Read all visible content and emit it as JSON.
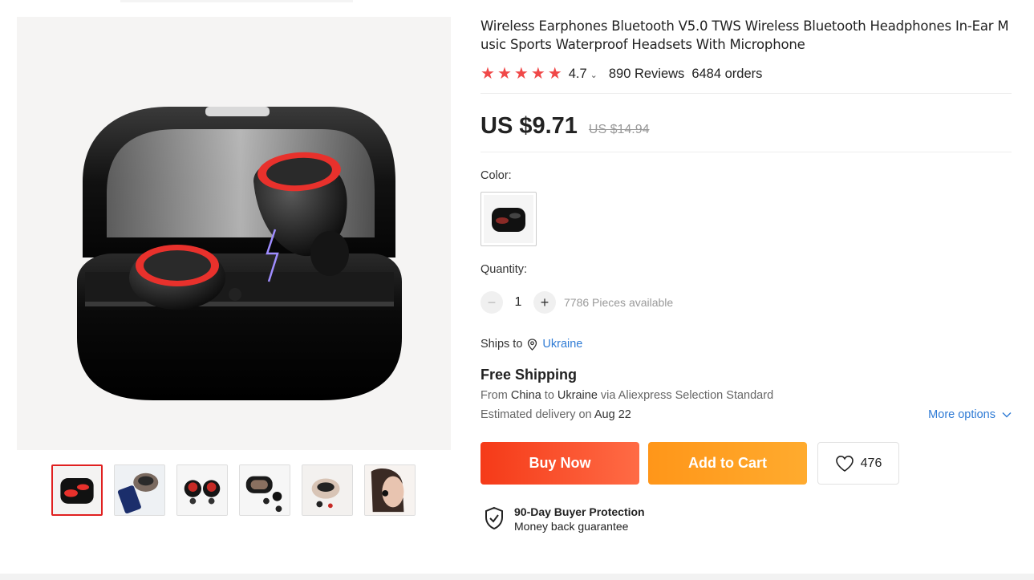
{
  "product": {
    "title": "Wireless Earphones Bluetooth V5.0 TWS Wireless Bluetooth Headphones In-Ear Music Sports Waterproof Headsets With Microphone",
    "rating": "4.7",
    "stars_filled": 5,
    "reviews": "890 Reviews",
    "orders": "6484 orders",
    "price": "US $9.71",
    "old_price": "US $14.94",
    "accent_color": "#f04848"
  },
  "gallery": {
    "main_image": "black-earbuds-charging-case-red-rings",
    "thumbnails": [
      "earbuds-case-open",
      "earbuds-with-phone",
      "two-earbuds",
      "case-and-buds",
      "case-closeup",
      "woman-wearing-earbud"
    ],
    "selected_index": 0
  },
  "color": {
    "label": "Color:",
    "selected": "black-earbuds-case"
  },
  "quantity": {
    "label": "Quantity:",
    "minus": "−",
    "value": "1",
    "plus": "+",
    "available": "7786 Pieces available"
  },
  "shipping": {
    "ships_to_label": "Ships to",
    "country": "Ukraine",
    "free_shipping": "Free Shipping",
    "route_from": "From",
    "route_origin": "China",
    "route_to": "to",
    "route_dest": "Ukraine",
    "route_via": "via Aliexpress Selection Standard",
    "delivery_label": "Estimated delivery on",
    "delivery_date": "Aug 22",
    "more_options": "More options"
  },
  "actions": {
    "buy_now": "Buy Now",
    "add_to_cart": "Add to Cart",
    "wishlist_count": "476"
  },
  "protection": {
    "title": "90-Day Buyer Protection",
    "subtitle": "Money back guarantee"
  }
}
